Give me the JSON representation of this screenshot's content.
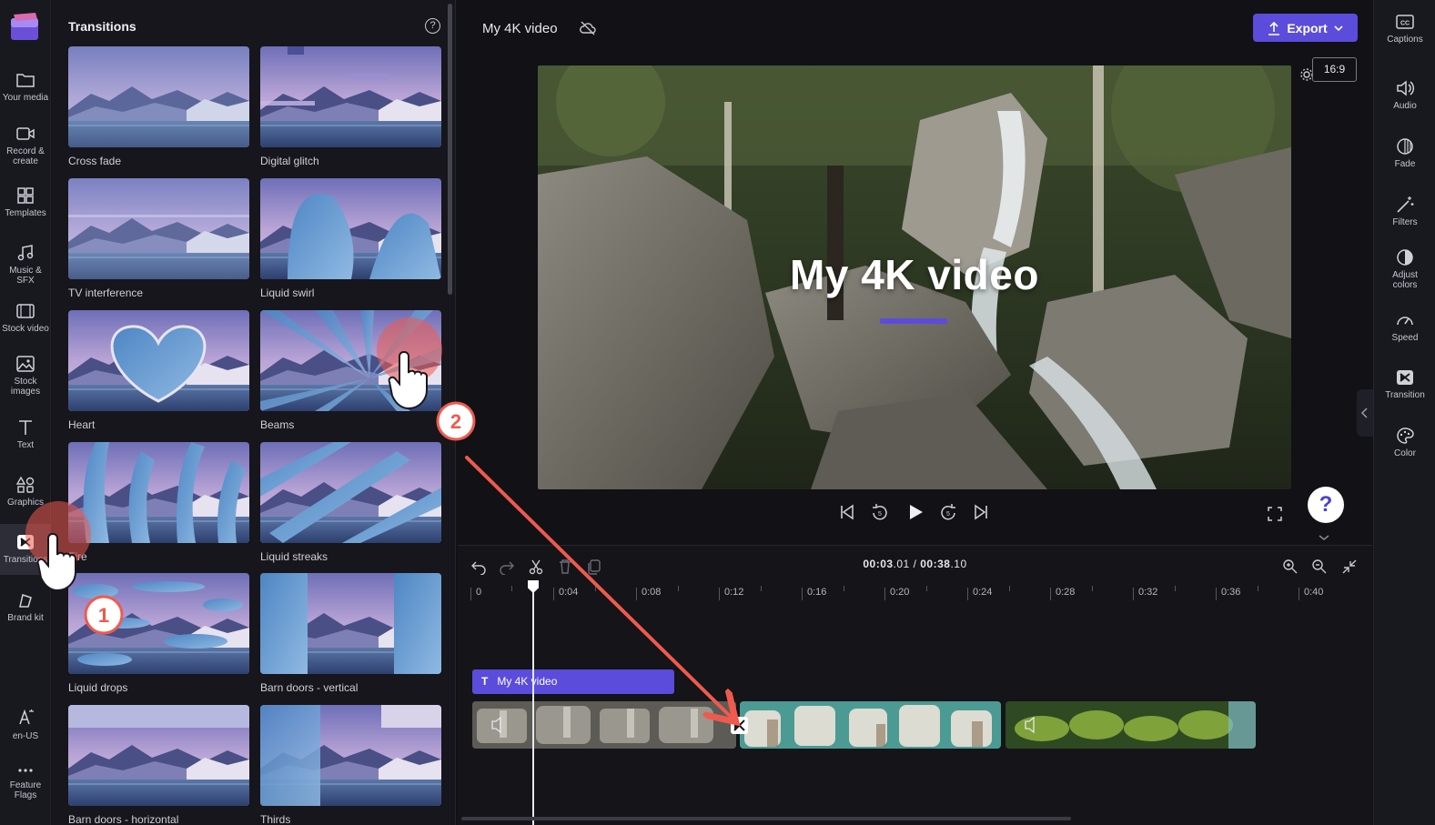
{
  "leftnav": {
    "items": [
      {
        "label": "Your media",
        "icon": "folder-icon"
      },
      {
        "label": "Record & create",
        "icon": "camera-icon"
      },
      {
        "label": "Templates",
        "icon": "templates-icon"
      },
      {
        "label": "Music & SFX",
        "icon": "music-icon"
      },
      {
        "label": "Stock video",
        "icon": "film-icon"
      },
      {
        "label": "Stock images",
        "icon": "image-icon"
      },
      {
        "label": "Text",
        "icon": "text-icon"
      },
      {
        "label": "Graphics",
        "icon": "shapes-icon"
      },
      {
        "label": "Transitions",
        "icon": "transitions-icon"
      },
      {
        "label": "Brand kit",
        "icon": "brand-icon"
      },
      {
        "label": "en-US",
        "icon": "language-icon"
      },
      {
        "label": "Feature Flags",
        "icon": "more-icon"
      }
    ]
  },
  "panel": {
    "title": "Transitions",
    "tiles": [
      {
        "label": "Cross fade"
      },
      {
        "label": "Digital glitch"
      },
      {
        "label": "TV interference"
      },
      {
        "label": "Liquid swirl"
      },
      {
        "label": "Heart"
      },
      {
        "label": "Beams"
      },
      {
        "label": "Fire"
      },
      {
        "label": "Liquid streaks"
      },
      {
        "label": "Liquid drops"
      },
      {
        "label": "Barn doors - vertical"
      },
      {
        "label": "Barn doors - horizontal"
      },
      {
        "label": "Thirds"
      }
    ]
  },
  "topbar": {
    "project_title": "My 4K video",
    "export_label": "Export"
  },
  "preview": {
    "overlay_title": "My 4K video",
    "aspect_ratio": "16:9",
    "help": "?"
  },
  "timeline": {
    "time_current": "00:03",
    "time_current_frac": ".01",
    "time_total": "00:38",
    "time_total_frac": ".10",
    "separator": " / ",
    "ticks": [
      "0",
      "0:04",
      "0:08",
      "0:12",
      "0:16",
      "0:20",
      "0:24",
      "0:28",
      "0:32",
      "0:36",
      "0:40"
    ],
    "text_clip": "My 4K video"
  },
  "rightbar": {
    "items": [
      {
        "label": "Captions",
        "icon": "captions-icon"
      },
      {
        "label": "Audio",
        "icon": "speaker-icon"
      },
      {
        "label": "Fade",
        "icon": "fade-icon"
      },
      {
        "label": "Filters",
        "icon": "magic-wand-icon"
      },
      {
        "label": "Adjust colors",
        "icon": "contrast-icon"
      },
      {
        "label": "Speed",
        "icon": "speedometer-icon"
      },
      {
        "label": "Transition",
        "icon": "transition-icon"
      },
      {
        "label": "Color",
        "icon": "palette-icon"
      }
    ]
  },
  "tutorial": {
    "step1": "1",
    "step2": "2"
  },
  "colors": {
    "accent": "#5b4cdb",
    "pointer": "#ef5a4e"
  }
}
